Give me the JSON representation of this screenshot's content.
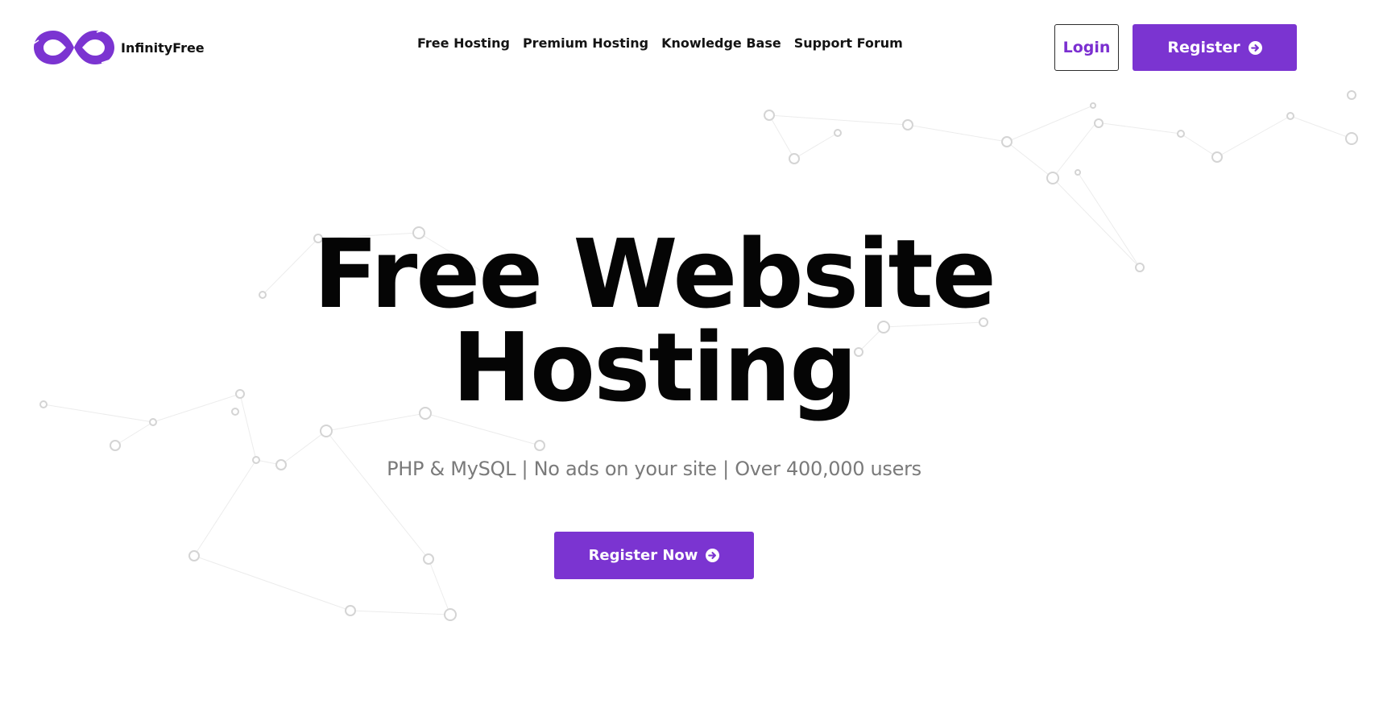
{
  "brand": {
    "name": "InfinityFree",
    "accent_color": "#7b34d1",
    "logo_icon": "infinity-logo-icon"
  },
  "nav": {
    "items": [
      {
        "label": "Free Hosting"
      },
      {
        "label": "Premium Hosting"
      },
      {
        "label": "Knowledge Base"
      },
      {
        "label": "Support Forum"
      }
    ]
  },
  "header_actions": {
    "login_label": "Login",
    "register_label": "Register",
    "register_icon": "arrow-right-circle-icon"
  },
  "hero": {
    "title_line1": "Free Website",
    "title_line2": "Hosting",
    "subtitle": "PHP & MySQL | No ads on your site | Over 400,000 users",
    "cta_label": "Register Now",
    "cta_icon": "arrow-right-circle-icon"
  }
}
